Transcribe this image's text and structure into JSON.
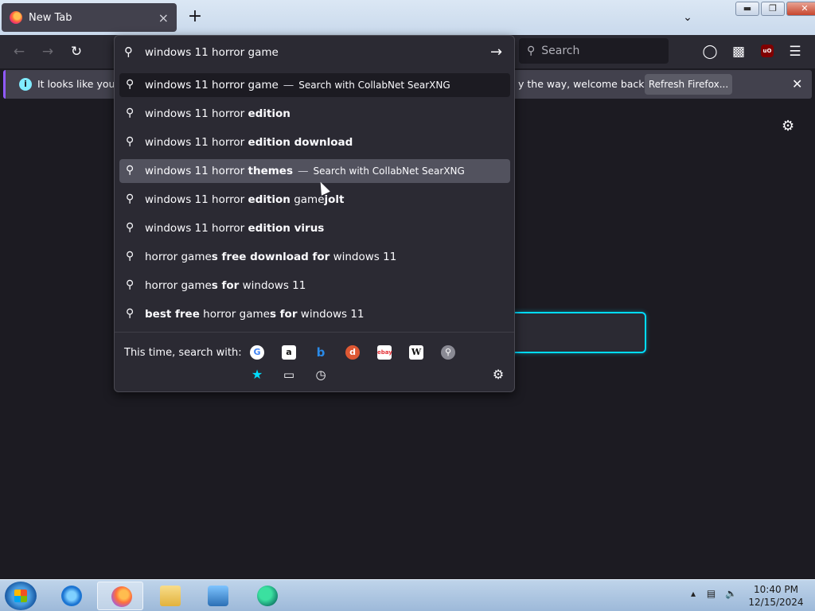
{
  "browser": {
    "tab_title": "New Tab",
    "tab_close": "×",
    "new_tab_label": "+",
    "search_placeholder": "Search"
  },
  "urlbar": {
    "value": "windows 11 horror game"
  },
  "notification": {
    "text_left": "It looks like you ha",
    "text_right": "y the way, welcome back!",
    "refresh_label": "Refresh Firefox..."
  },
  "results": [
    {
      "plain": "windows 11 horror game",
      "bold": "",
      "tail_plain": "",
      "tail_bold": "",
      "action": "Search with CollabNet SearXNG"
    },
    {
      "plain": "windows 11 horror ",
      "bold": "edition",
      "tail_plain": "",
      "tail_bold": "",
      "action": ""
    },
    {
      "plain": "windows 11 horror ",
      "bold": "edition download",
      "tail_plain": "",
      "tail_bold": "",
      "action": ""
    },
    {
      "plain": "windows 11 horror ",
      "bold": "themes",
      "tail_plain": "",
      "tail_bold": "",
      "action": "Search with CollabNet SearXNG"
    },
    {
      "plain": "windows 11 horror ",
      "bold": "edition",
      "tail_plain": " game",
      "tail_bold": "jolt",
      "action": ""
    },
    {
      "plain": "windows 11 horror ",
      "bold": "edition virus",
      "tail_plain": "",
      "tail_bold": "",
      "action": ""
    },
    {
      "plain": "horror game",
      "bold": "s free download for",
      "tail_plain": " windows 11",
      "tail_bold": "",
      "action": ""
    },
    {
      "plain": "horror game",
      "bold": "s for",
      "tail_plain": " windows 11",
      "tail_bold": "",
      "action": ""
    },
    {
      "plain": "",
      "bold": "best free",
      "tail_plain": " horror game",
      "tail_bold": "s for",
      "extra": " windows 11",
      "action": ""
    }
  ],
  "oneoff": {
    "label": "This time, search with:",
    "engines": [
      "google-icon",
      "amazon-icon",
      "bing-icon",
      "duckduckgo-icon",
      "ebay-icon",
      "wikipedia-icon",
      "searxng-icon",
      "bookmarks-icon",
      "tabs-icon",
      "history-icon"
    ]
  },
  "clock": {
    "time": "10:40 PM",
    "date": "12/15/2024"
  },
  "colors": {
    "accent": "#00ddff",
    "notif_accent": "#9059ff",
    "popup_bg": "#2b2a33",
    "page_bg": "#1c1b22"
  }
}
